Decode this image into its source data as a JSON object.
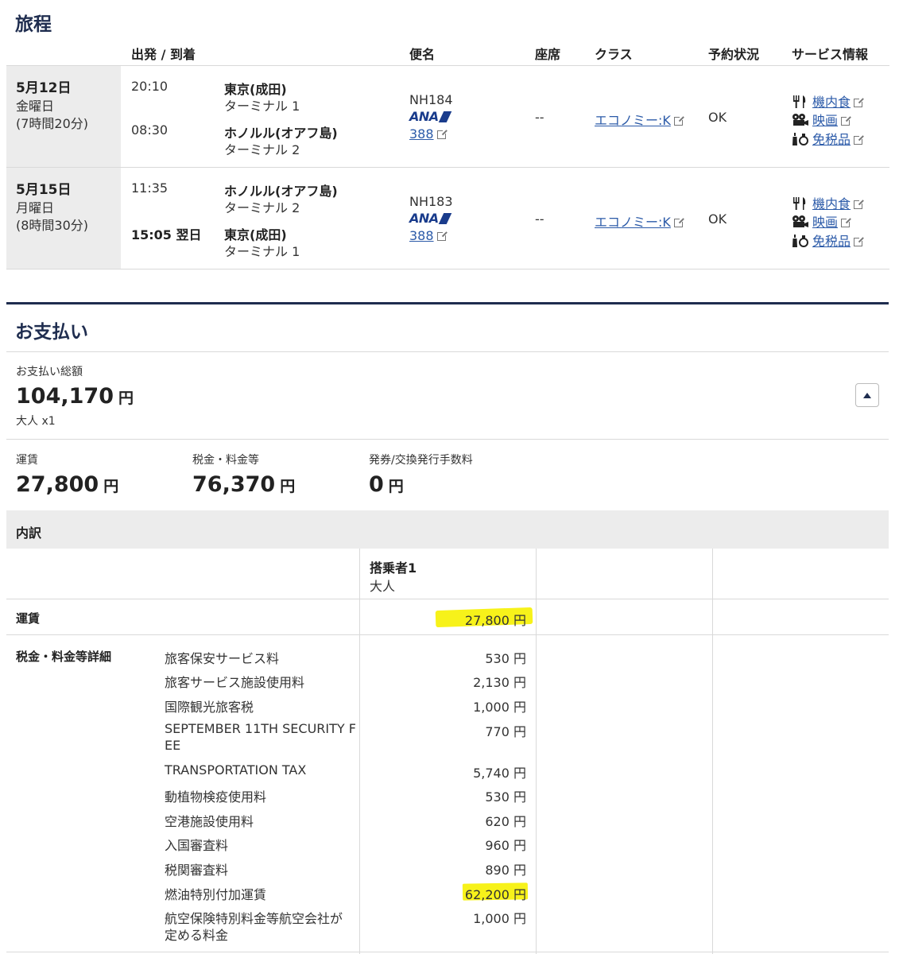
{
  "itinerary": {
    "title": "旅程",
    "headers": {
      "depart_arrive": "出発 / 到着",
      "flight": "便名",
      "seat": "座席",
      "class": "クラス",
      "status": "予約状況",
      "service": "サービス情報"
    },
    "flights": [
      {
        "date": "5月12日",
        "weekday": "金曜日",
        "duration": "(7時間20分)",
        "dep_time": "20:10",
        "dep_airport": "東京(成田)",
        "dep_terminal": "ターミナル 1",
        "arr_time": "08:30",
        "arr_airport": "ホノルル(オアフ島)",
        "arr_terminal": "ターミナル 2",
        "flight_no": "NH184",
        "airline_logo": "ANA",
        "aircraft": "388",
        "seat": "--",
        "class": "エコノミー:K",
        "status": "OK",
        "services": [
          "機内食",
          "映画",
          "免税品"
        ]
      },
      {
        "date": "5月15日",
        "weekday": "月曜日",
        "duration": "(8時間30分)",
        "dep_time": "11:35",
        "dep_airport": "ホノルル(オアフ島)",
        "dep_terminal": "ターミナル 2",
        "arr_time": "15:05 翌日",
        "arr_airport": "東京(成田)",
        "arr_terminal": "ターミナル 1",
        "flight_no": "NH183",
        "airline_logo": "ANA",
        "aircraft": "388",
        "seat": "--",
        "class": "エコノミー:K",
        "status": "OK",
        "services": [
          "機内食",
          "映画",
          "免税品"
        ]
      }
    ]
  },
  "payment": {
    "title": "お支払い",
    "total_label": "お支払い総額",
    "total_amount": "104,170",
    "yen": "円",
    "passengers": "大人 x1",
    "fare_label": "運賃",
    "fare_amount": "27,800",
    "tax_label": "税金・料金等",
    "tax_amount": "76,370",
    "fee_label": "発券/交換発行手数料",
    "fee_amount": "0"
  },
  "breakdown": {
    "title": "内訳",
    "passenger_label": "搭乗者1",
    "passenger_type": "大人",
    "fare_row_label": "運賃",
    "fare_row_amount": "27,800 円",
    "tax_section_label": "税金・料金等詳細",
    "tax_items": [
      {
        "name": "旅客保安サービス料",
        "amount": "530 円"
      },
      {
        "name": "旅客サービス施設使用料",
        "amount": "2,130 円"
      },
      {
        "name": "国際観光旅客税",
        "amount": "1,000 円"
      },
      {
        "name": "SEPTEMBER 11TH SECURITY F",
        "name2": "EE",
        "amount": "770 円"
      },
      {
        "name": "TRANSPORTATION TAX",
        "amount": "5,740 円"
      },
      {
        "name": "動植物検疫使用料",
        "amount": "530 円"
      },
      {
        "name": "空港施設使用料",
        "amount": "620 円"
      },
      {
        "name": "入国審査料",
        "amount": "960 円"
      },
      {
        "name": "税関審査料",
        "amount": "890 円"
      },
      {
        "name": "燃油特別付加運賃",
        "amount": "62,200 円"
      },
      {
        "name": "航空保険特別料金等航空会社が",
        "name2": "定める料金",
        "amount": "1,000 円"
      }
    ]
  },
  "colors": {
    "navy": "#1f2d4f",
    "link": "#2b5aa8",
    "highlight": "#f7f21a",
    "date_bg": "#ececec"
  }
}
